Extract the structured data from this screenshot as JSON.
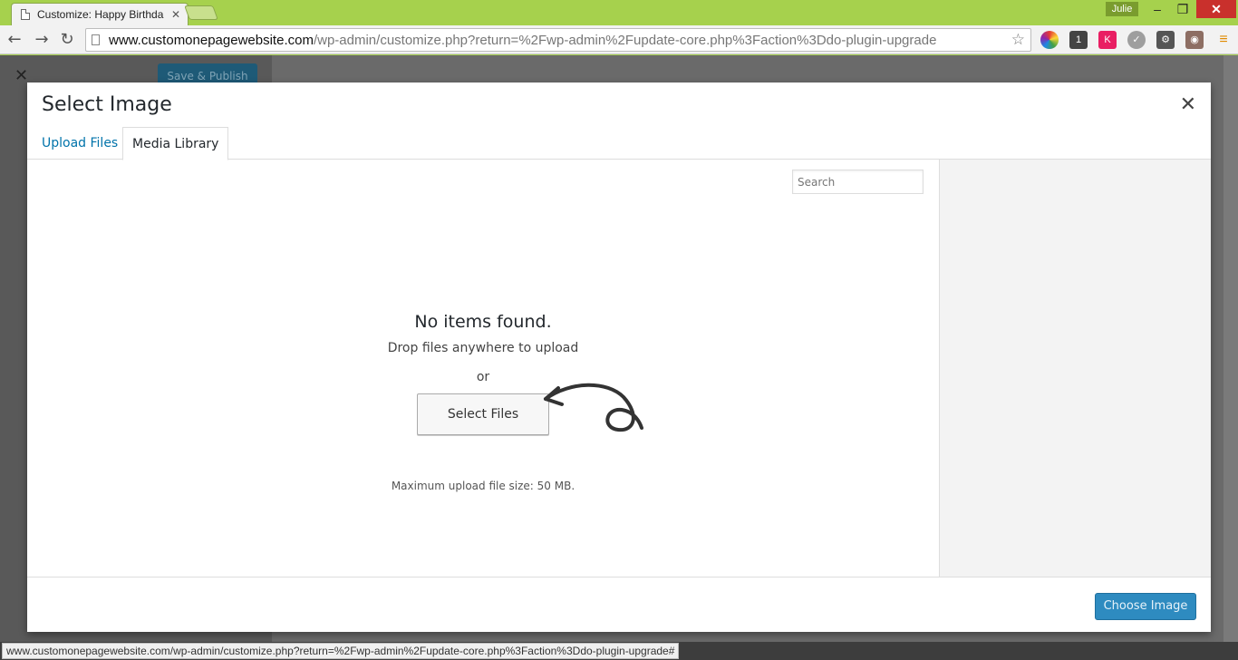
{
  "browser": {
    "tab_title": "Customize: Happy Birthda",
    "user_badge": "Julie",
    "url_host": "www.customonepagewebsite.com",
    "url_path": "/wp-admin/customize.php?return=%2Fwp-admin%2Fupdate-core.php%3Faction%3Ddo-plugin-upgrade",
    "status_url": "www.customonepagewebsite.com/wp-admin/customize.php?return=%2Fwp-admin%2Fupdate-core.php%3Faction%3Ddo-plugin-upgrade#"
  },
  "underlay": {
    "publish_label": "Save & Publish"
  },
  "modal": {
    "title": "Select Image",
    "tabs": [
      {
        "label": "Upload Files"
      },
      {
        "label": "Media Library"
      }
    ],
    "search_placeholder": "Search",
    "empty": {
      "heading": "No items found.",
      "drop_text": "Drop files anywhere to upload",
      "or_text": "or",
      "select_button": "Select Files",
      "max_size": "Maximum upload file size: 50 MB."
    },
    "choose_button": "Choose Image"
  }
}
